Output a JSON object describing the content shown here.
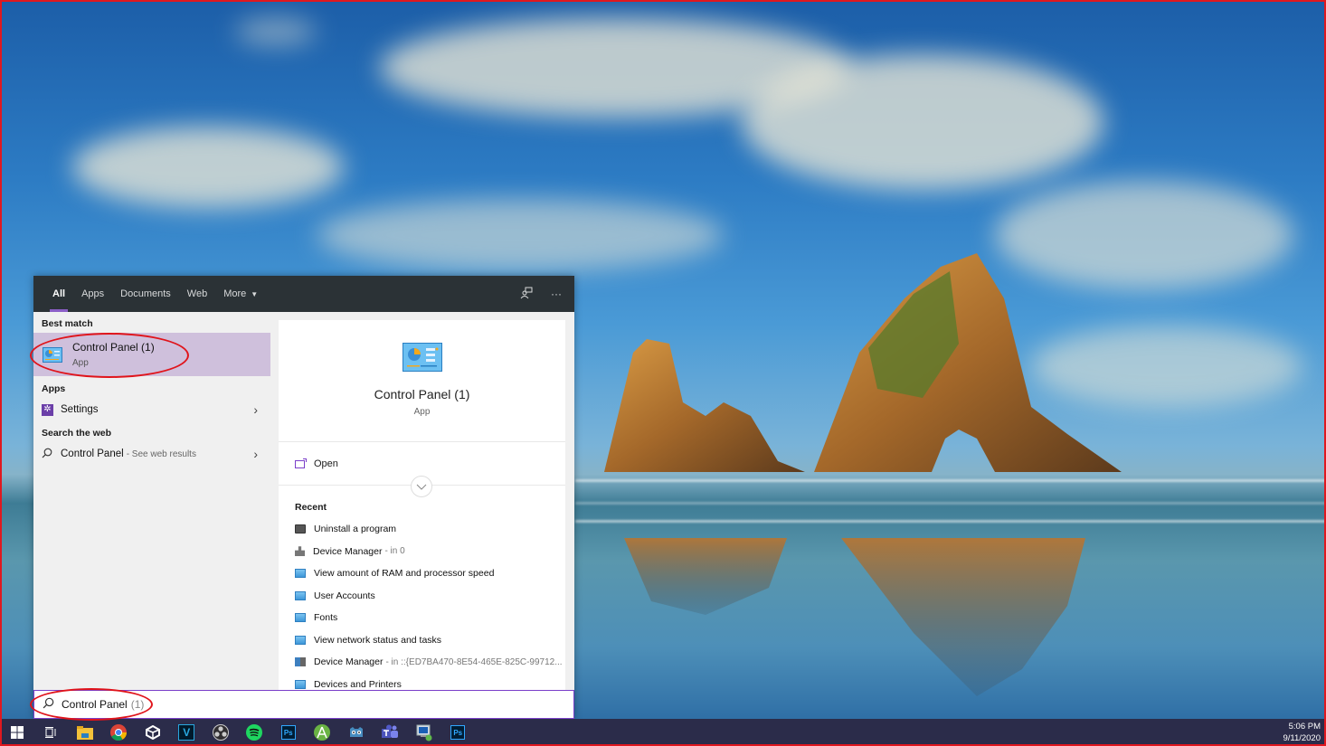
{
  "desktop": {
    "wallpaper": "sea-rocks-landscape"
  },
  "search": {
    "tabs": [
      {
        "label": "All",
        "active": true
      },
      {
        "label": "Apps"
      },
      {
        "label": "Documents"
      },
      {
        "label": "Web"
      },
      {
        "label": "More"
      }
    ],
    "header_icons": [
      "feedback-icon",
      "more-options-icon"
    ],
    "more_options_glyph": "···",
    "best_match_label": "Best match",
    "best_match": {
      "title": "Control Panel (1)",
      "type": "App"
    },
    "apps_label": "Apps",
    "apps": [
      {
        "label": "Settings"
      }
    ],
    "web_label": "Search the web",
    "web_result": {
      "label": "Control Panel",
      "hint": "- See web results"
    },
    "detail": {
      "title": "Control Panel (1)",
      "type": "App",
      "open_label": "Open",
      "recent_label": "Recent",
      "recent": [
        {
          "label": "Uninstall a program",
          "hint": "",
          "icon": "uninstall-icon"
        },
        {
          "label": "Device Manager",
          "hint": "- in 0",
          "icon": "device-manager-icon"
        },
        {
          "label": "View amount of RAM and processor speed",
          "hint": "",
          "icon": "control-panel-icon"
        },
        {
          "label": "User Accounts",
          "hint": "",
          "icon": "control-panel-icon"
        },
        {
          "label": "Fonts",
          "hint": "",
          "icon": "control-panel-icon"
        },
        {
          "label": "View network status and tasks",
          "hint": "",
          "icon": "control-panel-icon"
        },
        {
          "label": "Device Manager",
          "hint": "- in ::{ED7BA470-8E54-465E-825C-99712...",
          "icon": "device-manager-icon"
        },
        {
          "label": "Devices and Printers",
          "hint": "",
          "icon": "control-panel-icon"
        }
      ]
    },
    "query": {
      "typed": "Control Panel",
      "suggestion": "(1)"
    }
  },
  "taskbar": {
    "items": [
      {
        "name": "start-button",
        "glyph": "⊞"
      },
      {
        "name": "task-view-button",
        "glyph": "▯"
      },
      {
        "name": "file-explorer",
        "running": true
      },
      {
        "name": "chrome",
        "running": true
      },
      {
        "name": "unity"
      },
      {
        "name": "vegas",
        "glyph": "V"
      },
      {
        "name": "obs"
      },
      {
        "name": "spotify",
        "running": true
      },
      {
        "name": "photoshop",
        "glyph": "Ps"
      },
      {
        "name": "android-studio"
      },
      {
        "name": "godot"
      },
      {
        "name": "teams",
        "running": true
      },
      {
        "name": "remote-desktop",
        "running": true
      },
      {
        "name": "photoshop-2",
        "glyph": "Ps",
        "running": true
      }
    ],
    "clock": {
      "time": "5:06 PM",
      "date": "9/11/2020"
    }
  },
  "colors": {
    "accent": "#8c5fc7",
    "best_match_bg": "#cfc0dc",
    "annotation": "#e0141b",
    "taskbar": "#2b2c4a"
  }
}
